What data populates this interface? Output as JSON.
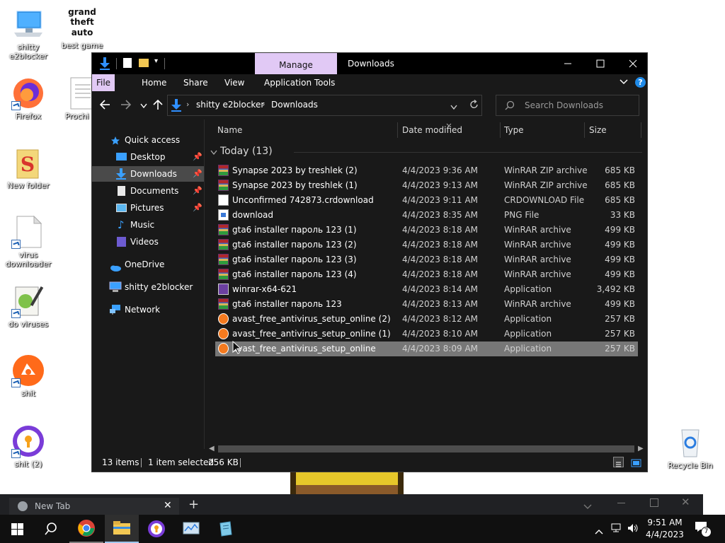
{
  "desktop": {
    "icons": [
      {
        "label": "shitty e2blocker",
        "icon": "computer-icon"
      },
      {
        "label": "best game",
        "icon": "gta-icon"
      },
      {
        "label": "Firefox",
        "icon": "firefox-icon"
      },
      {
        "label": "Prochi",
        "icon": "document-icon"
      },
      {
        "label": "New folder",
        "icon": "folder-icon"
      },
      {
        "label": "virus downloader",
        "icon": "blank-file-icon"
      },
      {
        "label": "do viruses",
        "icon": "batch-file-icon"
      },
      {
        "label": "shit",
        "icon": "avast-icon"
      },
      {
        "label": "shit (2)",
        "icon": "avast-secure-browser-icon"
      },
      {
        "label": "Recycle Bin",
        "icon": "recycle-bin-icon"
      }
    ]
  },
  "explorer": {
    "title": "Downloads",
    "manage_label": "Manage",
    "ribbon_tabs": [
      "File",
      "Home",
      "Share",
      "View",
      "Application Tools"
    ],
    "breadcrumb": [
      "shitty e2blocker",
      "Downloads"
    ],
    "search_placeholder": "Search Downloads",
    "sidebar": {
      "quick_access": "Quick access",
      "items": [
        {
          "label": "Desktop",
          "icon": "desktop-icon",
          "pinned": true
        },
        {
          "label": "Downloads",
          "icon": "downloads-icon",
          "pinned": true,
          "selected": true
        },
        {
          "label": "Documents",
          "icon": "documents-icon",
          "pinned": true
        },
        {
          "label": "Pictures",
          "icon": "pictures-icon",
          "pinned": true
        },
        {
          "label": "Music",
          "icon": "music-icon",
          "pinned": false
        },
        {
          "label": "Videos",
          "icon": "videos-icon",
          "pinned": false
        }
      ],
      "onedrive": "OneDrive",
      "this_pc": "shitty e2blocker",
      "network": "Network"
    },
    "columns": [
      "Name",
      "Date modified",
      "Type",
      "Size"
    ],
    "group_label": "Today (13)",
    "files": [
      {
        "name": "Synapse 2023 by treshlek (2)",
        "date": "4/4/2023 9:36 AM",
        "type": "WinRAR ZIP archive",
        "size": "685 KB",
        "icon": "rar"
      },
      {
        "name": "Synapse 2023 by treshlek (1)",
        "date": "4/4/2023 9:13 AM",
        "type": "WinRAR ZIP archive",
        "size": "685 KB",
        "icon": "rar"
      },
      {
        "name": "Unconfirmed 742873.crdownload",
        "date": "4/4/2023 9:11 AM",
        "type": "CRDOWNLOAD File",
        "size": "685 KB",
        "icon": "blankfile"
      },
      {
        "name": "download",
        "date": "4/4/2023 8:35 AM",
        "type": "PNG File",
        "size": "33 KB",
        "icon": "png"
      },
      {
        "name": "gta6 installer пароль 123 (1)",
        "date": "4/4/2023 8:18 AM",
        "type": "WinRAR archive",
        "size": "499 KB",
        "icon": "rar"
      },
      {
        "name": "gta6 installer пароль 123 (2)",
        "date": "4/4/2023 8:18 AM",
        "type": "WinRAR archive",
        "size": "499 KB",
        "icon": "rar"
      },
      {
        "name": "gta6 installer пароль 123 (3)",
        "date": "4/4/2023 8:18 AM",
        "type": "WinRAR archive",
        "size": "499 KB",
        "icon": "rar"
      },
      {
        "name": "gta6 installer пароль 123 (4)",
        "date": "4/4/2023 8:18 AM",
        "type": "WinRAR archive",
        "size": "499 KB",
        "icon": "rar"
      },
      {
        "name": "winrar-x64-621",
        "date": "4/4/2023 8:14 AM",
        "type": "Application",
        "size": "3,492 KB",
        "icon": "winrar"
      },
      {
        "name": "gta6 installer пароль 123",
        "date": "4/4/2023 8:13 AM",
        "type": "WinRAR archive",
        "size": "499 KB",
        "icon": "rar"
      },
      {
        "name": "avast_free_antivirus_setup_online (2)",
        "date": "4/4/2023 8:12 AM",
        "type": "Application",
        "size": "257 KB",
        "icon": "avast"
      },
      {
        "name": "avast_free_antivirus_setup_online (1)",
        "date": "4/4/2023 8:10 AM",
        "type": "Application",
        "size": "257 KB",
        "icon": "avast"
      },
      {
        "name": "avast_free_antivirus_setup_online",
        "date": "4/4/2023 8:09 AM",
        "type": "Application",
        "size": "257 KB",
        "icon": "avast",
        "selected": true
      }
    ],
    "status": {
      "items": "13 items",
      "selected": "1 item selected",
      "size": "256 KB"
    }
  },
  "chrome": {
    "tab_title": "New Tab",
    "new_tab_symbol": "+"
  },
  "taskbar": {
    "time": "9:51 AM",
    "date": "4/4/2023",
    "notifications": "7"
  },
  "colors": {
    "explorer_bg": "#191919",
    "manage_tab": "#e1c9f5",
    "selected_row": "#777777",
    "accent_blue": "#1f8ae8"
  }
}
